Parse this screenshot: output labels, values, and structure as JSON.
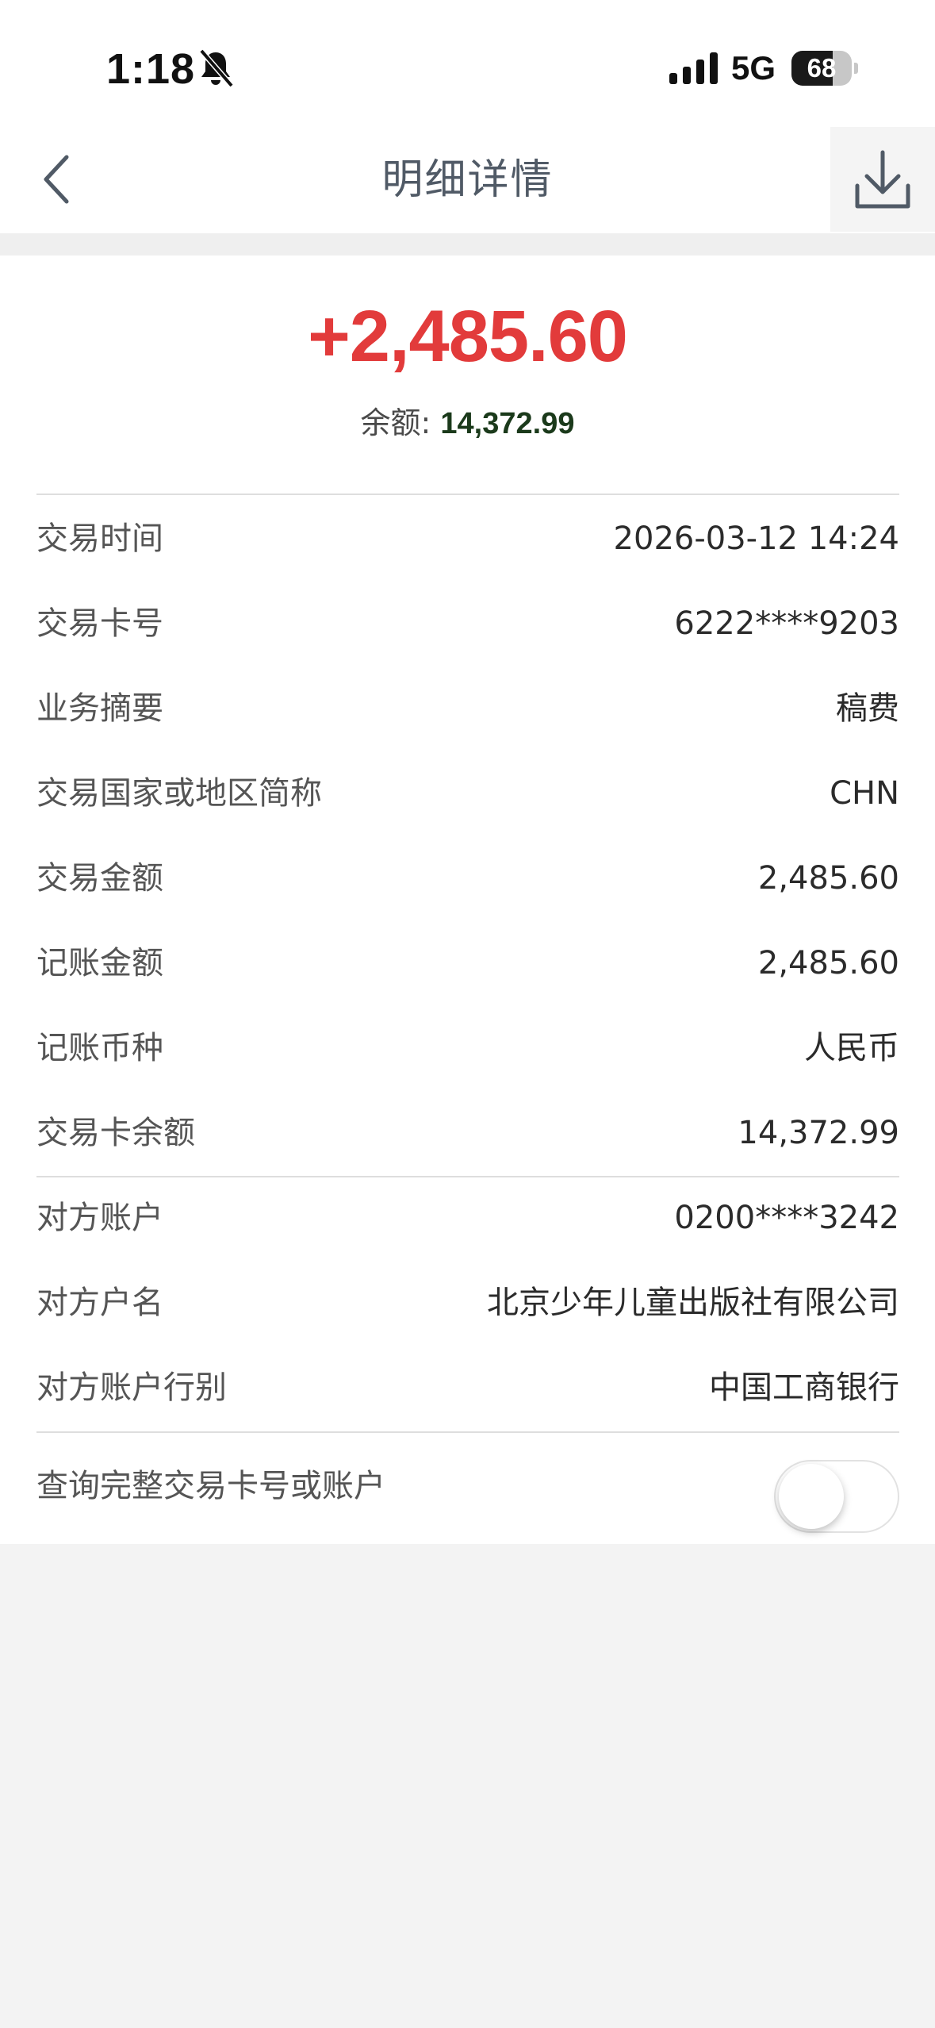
{
  "status_bar": {
    "time": "1:18",
    "network": "5G",
    "battery": "68",
    "battery_level": 0.68
  },
  "nav": {
    "title": "明细详情"
  },
  "summary": {
    "amount": "+2,485.60",
    "balance_label": "余额: ",
    "balance_value": "14,372.99"
  },
  "details": [
    {
      "label": "交易时间",
      "value": "2026-03-12 14:24"
    },
    {
      "label": "交易卡号",
      "value": "6222****9203"
    },
    {
      "label": "业务摘要",
      "value": "稿费"
    },
    {
      "label": "交易国家或地区简称",
      "value": "CHN"
    },
    {
      "label": "交易金额",
      "value": "2,485.60"
    },
    {
      "label": "记账金额",
      "value": "2,485.60"
    },
    {
      "label": "记账币种",
      "value": "人民币"
    },
    {
      "label": "交易卡余额",
      "value": "14,372.99"
    }
  ],
  "counterparty": [
    {
      "label": "对方账户",
      "value": "0200****3242"
    },
    {
      "label": "对方户名",
      "value": "北京少年儿童出版社有限公司"
    },
    {
      "label": "对方账户行别",
      "value": "中国工商银行"
    }
  ],
  "toggle": {
    "label": "查询完整交易卡号或账户",
    "on": false
  },
  "colors": {
    "amount": "#e23b3b",
    "title": "#505a66",
    "label": "#555555"
  }
}
